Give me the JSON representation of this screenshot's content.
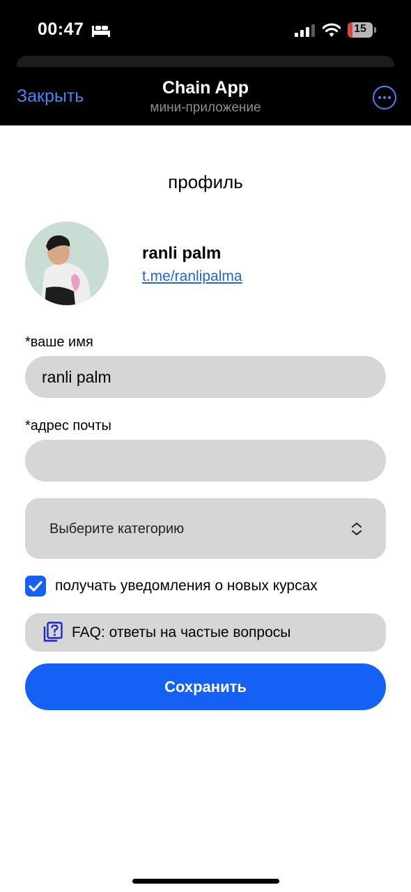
{
  "status_bar": {
    "time": "00:47",
    "battery": "15",
    "icons": [
      "bed-icon",
      "cellular-signal-icon",
      "wifi-icon",
      "battery-icon"
    ]
  },
  "nav": {
    "close_label": "Закрыть",
    "title": "Chain App",
    "subtitle": "мини-приложение",
    "more_icon": "more-icon"
  },
  "page": {
    "title": "профиль"
  },
  "profile": {
    "name": "ranli palm",
    "link": "t.me/ranlipalma"
  },
  "form": {
    "name_label": "*ваше имя",
    "name_value": "ranli palm",
    "email_label": "*адрес почты",
    "email_value": "",
    "category_placeholder": "Выберите категорию",
    "notifications_label": "получать уведомления о новых курсах",
    "notifications_checked": true,
    "faq_label": "FAQ: ответы на частые вопросы",
    "save_label": "Сохранить"
  },
  "colors": {
    "accent": "#1560f5",
    "nav_accent": "#3e88f7",
    "field_bg": "#d6d6d6",
    "link": "#2563d6",
    "battery_low": "#e0453d"
  }
}
